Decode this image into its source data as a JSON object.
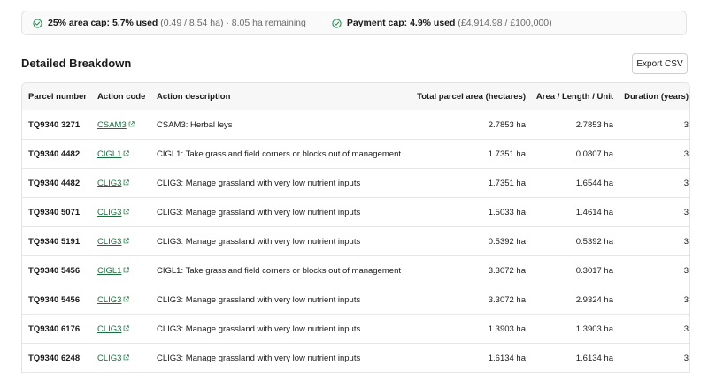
{
  "caps": {
    "area": {
      "label": "25% area cap: 5.7% used",
      "detail": "(0.49 / 8.54 ha)",
      "remaining": "· 8.05 ha remaining"
    },
    "payment": {
      "label": "Payment cap: 4.9% used",
      "detail": "(£4,914.98 / £100,000)"
    }
  },
  "breakdown": {
    "title": "Detailed Breakdown",
    "export_label": "Export CSV",
    "columns": [
      "Parcel number",
      "Action code",
      "Action description",
      "Total parcel area (hectares)",
      "Area / Length / Unit",
      "Duration (years)"
    ],
    "rows": [
      {
        "parcel": "TQ9340 3271",
        "code": "CSAM3",
        "description": "CSAM3: Herbal leys",
        "total_area": "2.7853 ha",
        "unit_area": "2.7853 ha",
        "duration": "3"
      },
      {
        "parcel": "TQ9340 4482",
        "code": "CIGL1",
        "description": "CIGL1: Take grassland field corners or blocks out of management",
        "total_area": "1.7351 ha",
        "unit_area": "0.0807 ha",
        "duration": "3"
      },
      {
        "parcel": "TQ9340 4482",
        "code": "CLIG3",
        "description": "CLIG3: Manage grassland with very low nutrient inputs",
        "total_area": "1.7351 ha",
        "unit_area": "1.6544 ha",
        "duration": "3"
      },
      {
        "parcel": "TQ9340 5071",
        "code": "CLIG3",
        "description": "CLIG3: Manage grassland with very low nutrient inputs",
        "total_area": "1.5033 ha",
        "unit_area": "1.4614 ha",
        "duration": "3"
      },
      {
        "parcel": "TQ9340 5191",
        "code": "CLIG3",
        "description": "CLIG3: Manage grassland with very low nutrient inputs",
        "total_area": "0.5392 ha",
        "unit_area": "0.5392 ha",
        "duration": "3"
      },
      {
        "parcel": "TQ9340 5456",
        "code": "CIGL1",
        "description": "CIGL1: Take grassland field corners or blocks out of management",
        "total_area": "3.3072 ha",
        "unit_area": "0.3017 ha",
        "duration": "3"
      },
      {
        "parcel": "TQ9340 5456",
        "code": "CLIG3",
        "description": "CLIG3: Manage grassland with very low nutrient inputs",
        "total_area": "3.3072 ha",
        "unit_area": "2.9324 ha",
        "duration": "3"
      },
      {
        "parcel": "TQ9340 6176",
        "code": "CLIG3",
        "description": "CLIG3: Manage grassland with very low nutrient inputs",
        "total_area": "1.3903 ha",
        "unit_area": "1.3903 ha",
        "duration": "3"
      },
      {
        "parcel": "TQ9340 6248",
        "code": "CLIG3",
        "description": "CLIG3: Manage grassland with very low nutrient inputs",
        "total_area": "1.6134 ha",
        "unit_area": "1.6134 ha",
        "duration": "3"
      }
    ]
  },
  "colors": {
    "link": "#1d6e3e",
    "check": "#2e8b57"
  }
}
